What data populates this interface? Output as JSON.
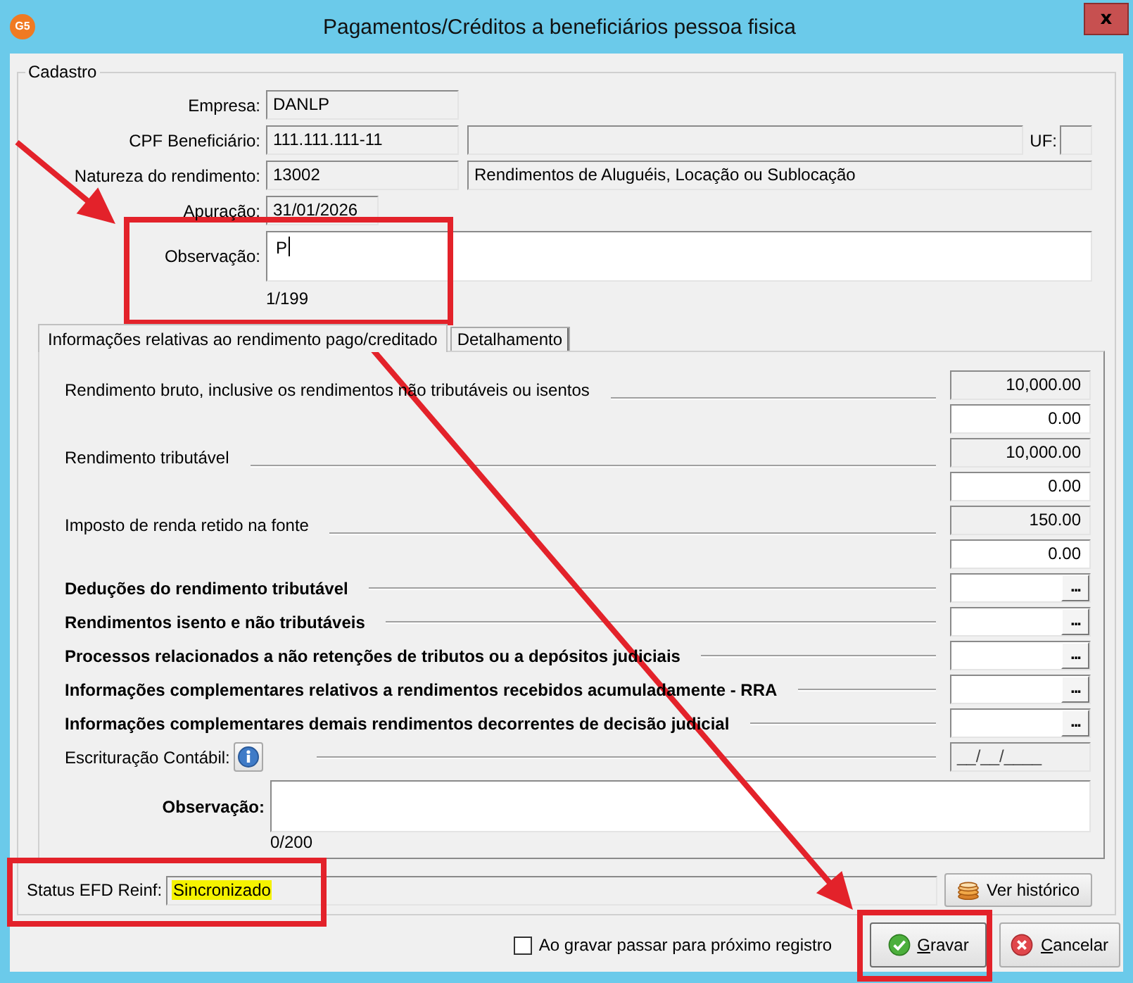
{
  "window": {
    "title": "Pagamentos/Créditos a beneficiários pessoa fisica",
    "icon_label": "G5",
    "close_label": "x"
  },
  "cadastro": {
    "legend": "Cadastro",
    "empresa": {
      "label": "Empresa:",
      "value": "DANLP"
    },
    "cpf": {
      "label": "CPF Beneficiário:",
      "value": "111.111.111-11",
      "uf_label": "UF:"
    },
    "natureza": {
      "label": "Natureza do rendimento:",
      "code": "13002",
      "description": "Rendimentos de Aluguéis, Locação ou Sublocação"
    },
    "apuracao": {
      "label": "Apuração:",
      "value": "31/01/2026"
    },
    "observacao": {
      "label": "Observação:",
      "value": "P",
      "counter": "1/199",
      "focused": true
    }
  },
  "tabs": [
    {
      "label": "Informações relativas ao rendimento pago/creditado",
      "selected": true
    },
    {
      "label": "Detalhamento",
      "selected": false
    }
  ],
  "panel": {
    "rows": [
      {
        "kind": "amount",
        "label": "Rendimento bruto, inclusive os rendimentos não tributáveis ou isentos",
        "total": "10,000.00",
        "value": "0.00"
      },
      {
        "kind": "amount",
        "label": "Rendimento tributável",
        "total": "10,000.00",
        "value": "0.00"
      },
      {
        "kind": "amount",
        "label": "Imposto de renda retido na fonte",
        "total": "150.00",
        "value": "0.00"
      },
      {
        "kind": "lookup",
        "label": "Deduções do rendimento tributável",
        "button": "..."
      },
      {
        "kind": "lookup",
        "label": "Rendimentos isento e não tributáveis",
        "button": "..."
      },
      {
        "kind": "lookup",
        "label": "Processos relacionados a não retenções de tributos ou a depósitos judiciais",
        "button": "..."
      },
      {
        "kind": "lookup",
        "label": "Informações complementares relativos a rendimentos recebidos acumuladamente - RRA",
        "button": "..."
      },
      {
        "kind": "lookup",
        "label": "Informações complementares demais rendimentos decorrentes de decisão judicial",
        "button": "..."
      },
      {
        "kind": "date",
        "label": "Escrituração Contábil:",
        "value": "__/__/____"
      }
    ],
    "observacao": {
      "label": "Observação:",
      "counter": "0/200"
    }
  },
  "status": {
    "label": "Status EFD Reinf:",
    "value": "Sincronizado",
    "highlighted": true,
    "history_button": "Ver histórico"
  },
  "footer": {
    "checkbox": {
      "label": "Ao gravar passar para próximo registro",
      "checked": false
    },
    "buttons": [
      {
        "kind": "save",
        "label": "Gravar"
      },
      {
        "kind": "cancel",
        "label": "Cancelar"
      }
    ]
  },
  "annotations": [
    {
      "kind": "arrow"
    },
    {
      "kind": "frame"
    },
    {
      "kind": "frame"
    },
    {
      "kind": "frame"
    },
    {
      "kind": "arrow"
    }
  ]
}
